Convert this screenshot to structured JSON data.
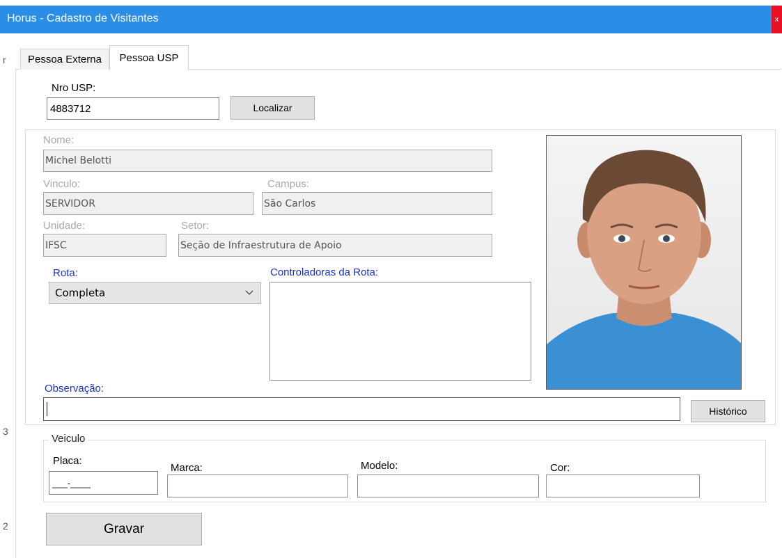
{
  "window": {
    "title": "Horus - Cadastro de Visitantes",
    "close_label": "x"
  },
  "background_window": {
    "marks": [
      "r",
      "3",
      "2"
    ]
  },
  "tabs": [
    {
      "label": "Pessoa Externa",
      "active": false
    },
    {
      "label": "Pessoa USP",
      "active": true
    }
  ],
  "search": {
    "label": "Nro USP:",
    "value": "4883712",
    "button_label": "Localizar"
  },
  "person": {
    "nome_label": "Nome:",
    "nome_value": "Michel Belotti",
    "vinculo_label": "Vinculo:",
    "vinculo_value": "SERVIDOR",
    "campus_label": "Campus:",
    "campus_value": "São Carlos",
    "unidade_label": "Unidade:",
    "unidade_value": "IFSC",
    "setor_label": "Setor:",
    "setor_value": "Seção de Infraestrutura de Apoio"
  },
  "rota": {
    "label": "Rota:",
    "selected": "Completa",
    "controladoras_label": "Controladoras da Rota:",
    "controladoras_items": []
  },
  "observacao": {
    "label": "Observação:",
    "value": "",
    "historico_button": "Histórico"
  },
  "veiculo": {
    "legend": "Veiculo",
    "placa_label": "Placa:",
    "placa_mask": "___-____",
    "marca_label": "Marca:",
    "modelo_label": "Modelo:",
    "cor_label": "Cor:"
  },
  "actions": {
    "gravar_label": "Gravar"
  },
  "colors": {
    "titlebar": "#2b8ee6",
    "link_label": "#1a31c8",
    "readonly_bg": "#f0f0f0"
  }
}
